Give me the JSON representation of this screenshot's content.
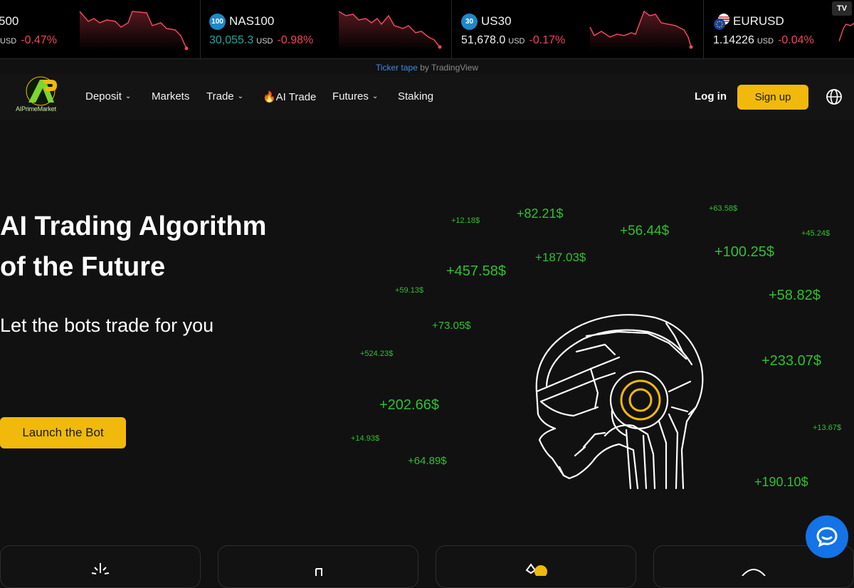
{
  "ticker": {
    "items": [
      {
        "symbol": "500",
        "badge": "",
        "price": "",
        "unit": "USD",
        "change": "-0.47%"
      },
      {
        "symbol": "NAS100",
        "badge": "100",
        "price": "30,055.3",
        "unit": "USD",
        "change": "-0.98%",
        "price_color": "#26a69a"
      },
      {
        "symbol": "US30",
        "badge": "30",
        "price": "51,678.0",
        "unit": "USD",
        "change": "-0.17%"
      },
      {
        "symbol": "EURUSD",
        "badge": "",
        "price": "1.14226",
        "unit": "USD",
        "change": "-0.04%"
      }
    ],
    "credit_link": "Ticker tape",
    "credit_rest": " by TradingView",
    "tv_logo": "TV"
  },
  "nav": {
    "brand": "AIPrimeMarket",
    "items": [
      {
        "label": "Deposit",
        "has_dropdown": true
      },
      {
        "label": "Markets",
        "has_dropdown": false
      },
      {
        "label": "Trade",
        "has_dropdown": true
      },
      {
        "label": "🔥AI Trade",
        "has_dropdown": false
      },
      {
        "label": "Futures",
        "has_dropdown": true
      },
      {
        "label": "Staking",
        "has_dropdown": false
      }
    ],
    "login": "Log in",
    "signup": "Sign up",
    "language_icon": "globe-icon"
  },
  "hero": {
    "title_line1": "AI Trading Algorithm",
    "title_line2": "of the Future",
    "subtitle": "Let the bots trade for you",
    "cta": "Launch the Bot"
  },
  "profits": [
    "+12.18$",
    "+82.21$",
    "+56.44$",
    "+63.58$",
    "+45.24$",
    "+187.03$",
    "+100.25$",
    "+457.58$",
    "+59.13$",
    "+58.82$",
    "+73.05$",
    "+524.23$",
    "+233.07$",
    "+202.66$",
    "+13.67$",
    "+14.93$",
    "+64.89$",
    "+190.10$"
  ],
  "colors": {
    "accent": "#f0b90b",
    "profit": "#2fc12f",
    "negative": "#f0475a",
    "positive_price": "#26a69a",
    "chat": "#1473e6"
  }
}
